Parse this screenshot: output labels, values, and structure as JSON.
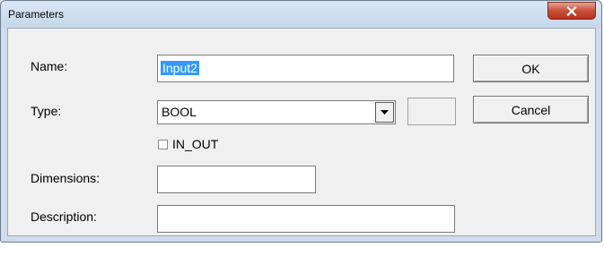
{
  "window": {
    "title": "Parameters",
    "close_glyph": "x"
  },
  "form": {
    "name_label": "Name:",
    "name_value": "Input2",
    "type_label": "Type:",
    "type_value": "BOOL",
    "in_out_label": "IN_OUT",
    "in_out_checked": false,
    "dimensions_label": "Dimensions:",
    "dimensions_value": "",
    "description_label": "Description:",
    "description_value": ""
  },
  "buttons": {
    "ok_label": "OK",
    "cancel_label": "Cancel"
  },
  "icons": {
    "close": "close-icon",
    "dropdown": "chevron-down-icon"
  },
  "colors": {
    "selection": "#3399ff",
    "close_button": "#c7503a"
  }
}
